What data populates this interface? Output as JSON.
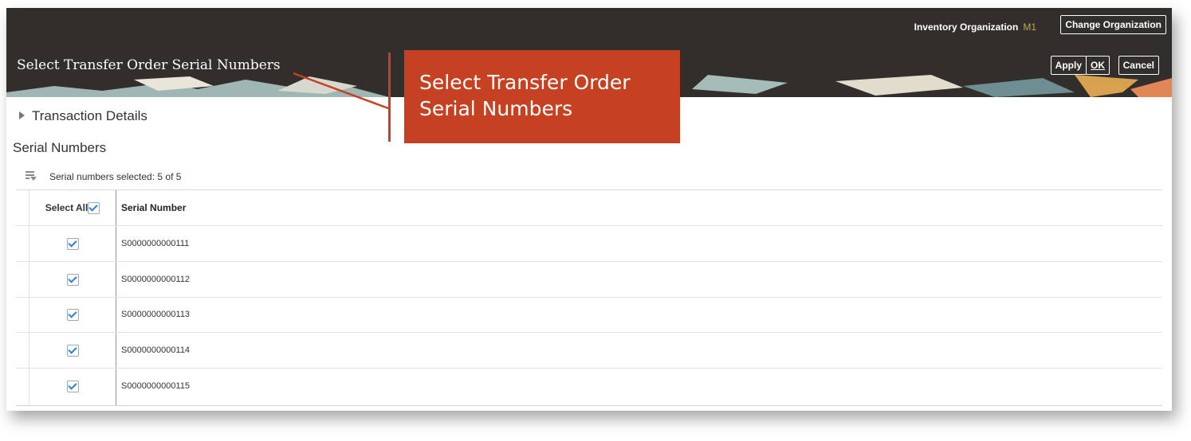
{
  "header": {
    "org_label": "Inventory Organization",
    "org_value": "M1",
    "change_org_button": "Change Organization",
    "page_title": "Select Transfer Order Serial Numbers",
    "apply_button": "Apply",
    "ok_button": "OK",
    "cancel_button": "Cancel"
  },
  "sections": {
    "transaction_details": "Transaction Details",
    "serial_numbers": "Serial Numbers"
  },
  "toolbar": {
    "status": "Serial numbers selected: 5 of 5"
  },
  "table": {
    "select_all_label": "Select All",
    "select_all_checked": true,
    "column_serial": "Serial Number",
    "rows": [
      {
        "serial": "S0000000000111",
        "checked": true
      },
      {
        "serial": "S0000000000112",
        "checked": true
      },
      {
        "serial": "S0000000000113",
        "checked": true
      },
      {
        "serial": "S0000000000114",
        "checked": true
      },
      {
        "serial": "S0000000000115",
        "checked": true
      }
    ]
  },
  "callout": {
    "text_line1": "Select Transfer Order",
    "text_line2": "Serial Numbers",
    "color": "#c54121"
  },
  "colors": {
    "header_bg": "#322e2c",
    "org_value": "#c9a955",
    "checkbox_check": "#2f7fce",
    "column_divider": "#4fb0b5"
  }
}
